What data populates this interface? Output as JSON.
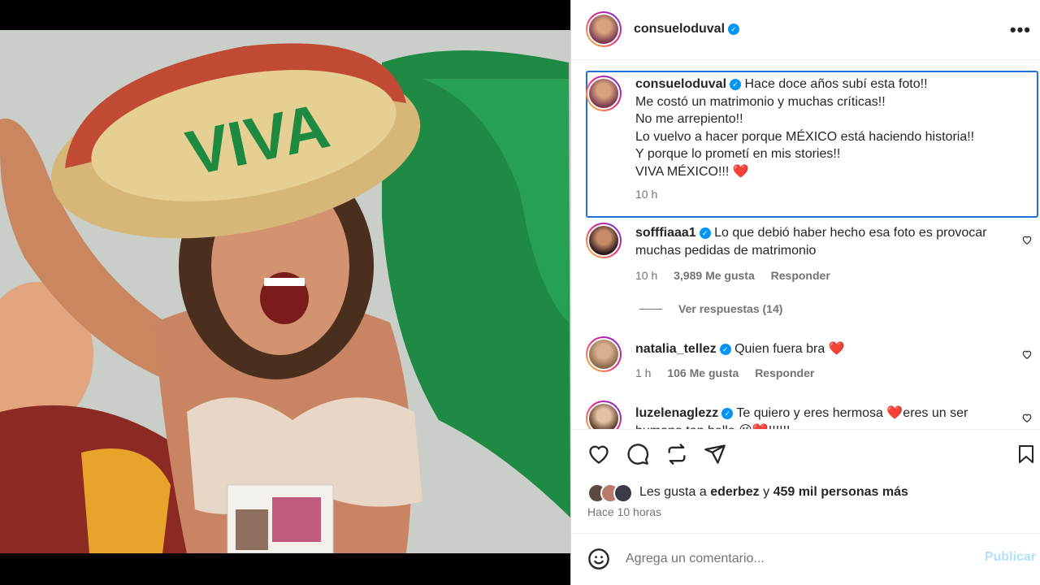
{
  "post": {
    "author": "consueloduval",
    "verified": true,
    "more_label": "•••"
  },
  "caption": {
    "author": "consueloduval",
    "lines": [
      "Hace doce años subí esta foto!!",
      "Me costó un matrimonio y muchas críticas!!",
      "No me arrepiento!!",
      "Lo vuelvo a hacer porque MÉXICO está haciendo historia!!",
      "Y porque lo prometí en mis stories!!",
      "VIVA MÉXICO!!! ❤️"
    ],
    "time": "10 h"
  },
  "comments": [
    {
      "author": "sofffiaaa1",
      "text": "Lo que debió haber hecho esa foto es provocar muchas pedidas de matrimonio",
      "time": "10 h",
      "likes": "3,989 Me gusta",
      "reply": "Responder",
      "view_replies": "Ver respuestas (14)"
    },
    {
      "author": "natalia_tellez",
      "text": "Quien fuera bra ❤️",
      "time": "1 h",
      "likes": "106 Me gusta",
      "reply": "Responder"
    },
    {
      "author": "luzelenaglezz",
      "text": "Te quiero y eres hermosa ❤️eres un ser humano tan bello 😘❤️!!!!!!",
      "time": "",
      "likes": "",
      "reply": ""
    }
  ],
  "likes": {
    "prefix": "Les gusta a",
    "user": "ederbez",
    "connector": "y",
    "count": "459 mil personas más"
  },
  "posted": "Hace 10 horas",
  "add_comment": {
    "placeholder": "Agrega un comentario...",
    "publish": "Publicar"
  },
  "photo": {
    "hat_text": "VIVA"
  },
  "colors": {
    "accent": "#0095f6",
    "caption_border": "#1f6fdc",
    "publish_disabled": "#b2dffc",
    "muted": "#737373"
  }
}
